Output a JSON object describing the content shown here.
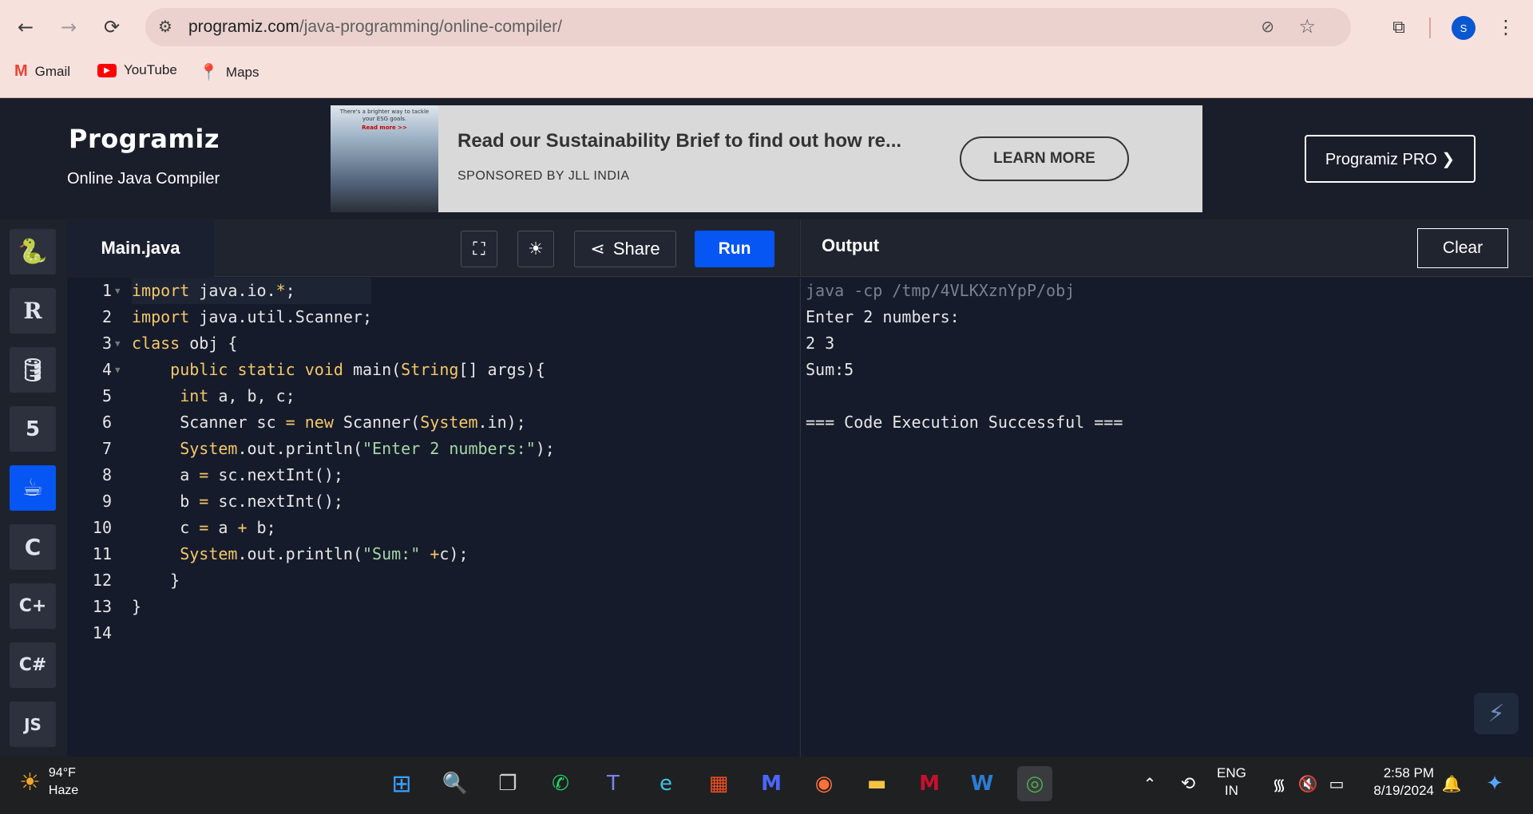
{
  "browser": {
    "url_host": "programiz.com",
    "url_path": "/java-programming/online-compiler/",
    "profile_initial": "S",
    "bookmarks": [
      {
        "label": "Gmail",
        "icon": "gmail-icon"
      },
      {
        "label": "YouTube",
        "icon": "youtube-icon"
      },
      {
        "label": "Maps",
        "icon": "maps-icon"
      }
    ]
  },
  "site": {
    "logo": "Programiz",
    "subtitle": "Online Java Compiler",
    "pro_button": "Programiz PRO ❯"
  },
  "ad": {
    "image_text": "There's a brighter way to tackle your ESG goals.",
    "image_link": "Read more >>",
    "title": "Read our Sustainability Brief to find out how re...",
    "sponsor": "SPONSORED BY JLL INDIA",
    "button": "LEARN MORE"
  },
  "languages": [
    {
      "name": "python-icon",
      "glyph": "🐍"
    },
    {
      "name": "r-icon",
      "glyph": "R"
    },
    {
      "name": "sql-icon",
      "glyph": "🛢"
    },
    {
      "name": "html-icon",
      "glyph": "5"
    },
    {
      "name": "java-icon",
      "glyph": "☕",
      "active": true
    },
    {
      "name": "c-icon",
      "glyph": "C"
    },
    {
      "name": "cpp-icon",
      "glyph": "C+"
    },
    {
      "name": "csharp-icon",
      "glyph": "C#"
    },
    {
      "name": "js-icon",
      "glyph": "JS"
    }
  ],
  "editor": {
    "filename": "Main.java",
    "share_label": "Share",
    "run_label": "Run",
    "lines": [
      {
        "n": "1",
        "code": "import java.io.*;"
      },
      {
        "n": "2",
        "code": "import java.util.Scanner;"
      },
      {
        "n": "3",
        "code": "class obj {"
      },
      {
        "n": "4",
        "code": "    public static void main(String[] args){"
      },
      {
        "n": "5",
        "code": "     int a, b, c;"
      },
      {
        "n": "6",
        "code": "     Scanner sc = new Scanner(System.in);"
      },
      {
        "n": "7",
        "code": "     System.out.println(\"Enter 2 numbers:\");"
      },
      {
        "n": "8",
        "code": "     a = sc.nextInt();"
      },
      {
        "n": "9",
        "code": "     b = sc.nextInt();"
      },
      {
        "n": "10",
        "code": "     c = a + b;"
      },
      {
        "n": "11",
        "code": "     System.out.println(\"Sum:\" +c);"
      },
      {
        "n": "12",
        "code": "    }"
      },
      {
        "n": "13",
        "code": "}"
      },
      {
        "n": "14",
        "code": ""
      }
    ]
  },
  "output": {
    "title": "Output",
    "clear_label": "Clear",
    "lines": [
      "java -cp /tmp/4VLKXznYpP/obj",
      "Enter 2 numbers:",
      "2 3",
      "Sum:5",
      "",
      "=== Code Execution Successful ==="
    ]
  },
  "taskbar": {
    "temp": "94°F",
    "condition": "Haze",
    "lang_top": "ENG",
    "lang_bottom": "IN",
    "time": "2:58 PM",
    "date": "8/19/2024"
  }
}
